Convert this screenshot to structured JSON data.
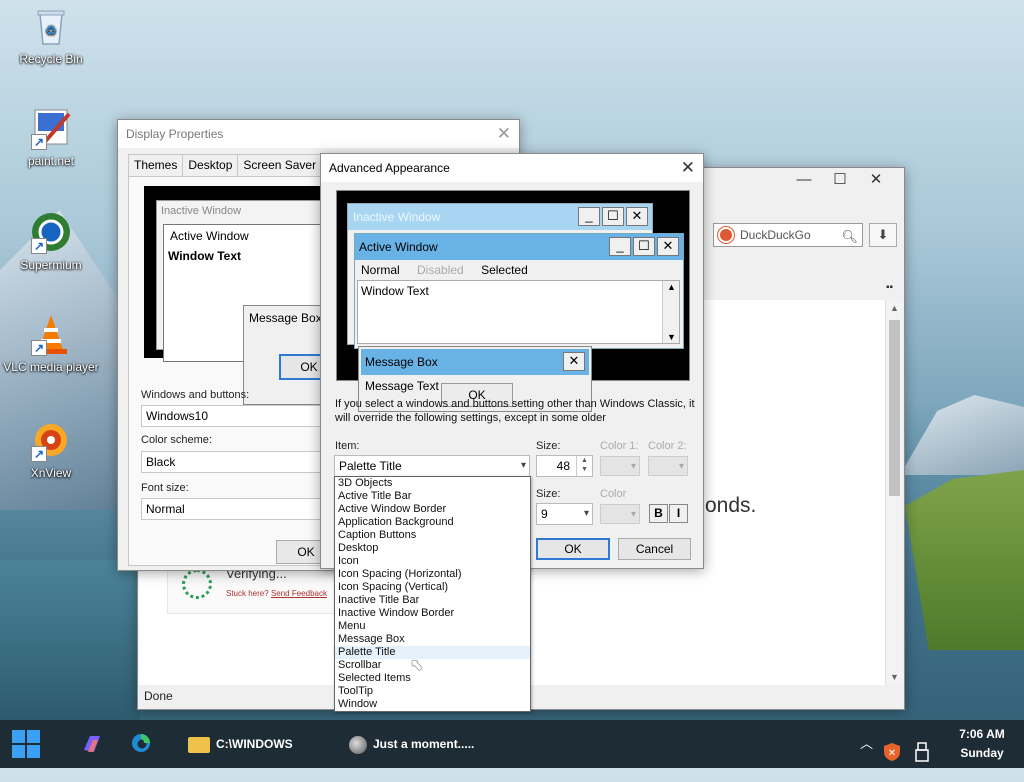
{
  "desktop": {
    "icons": [
      {
        "label": "Recycle Bin"
      },
      {
        "label": "paint.net"
      },
      {
        "label": "Supermium"
      },
      {
        "label": "VLC media player"
      },
      {
        "label": "XnView"
      }
    ]
  },
  "browser": {
    "search_placeholder": "DuckDuckGo",
    "seconds_text": "onds.",
    "verifying": "Verifying...",
    "stuck_text": "Stuck here?",
    "stuck_link": "Send Feedback",
    "status": "Done"
  },
  "display_properties": {
    "title": "Display Properties",
    "tabs": [
      "Themes",
      "Desktop",
      "Screen Saver",
      "A"
    ],
    "preview": {
      "inactive": "Inactive Window",
      "active": "Active Window",
      "window_text": "Window Text",
      "message_box": "Message Box",
      "ok": "OK"
    },
    "windows_buttons_label": "Windows and buttons:",
    "windows_buttons_value": "Windows10",
    "color_scheme_label": "Color scheme:",
    "color_scheme_value": "Black",
    "font_size_label": "Font size:",
    "font_size_value": "Normal",
    "ok": "OK"
  },
  "advanced": {
    "title": "Advanced Appearance",
    "preview": {
      "inactive": "Inactive Window",
      "active": "Active Window",
      "menu_normal": "Normal",
      "menu_disabled": "Disabled",
      "menu_selected": "Selected",
      "window_text": "Window Text",
      "message_box": "Message Box",
      "message_text": "Message Text",
      "ok": "OK"
    },
    "help_text": "If you select a windows and buttons setting other than Windows Classic, it will override the following settings, except in some older",
    "item_label": "Item:",
    "item_value": "Palette Title",
    "size_label": "Size:",
    "size_value": "48",
    "color1_label": "Color 1:",
    "color2_label": "Color 2:",
    "font_size_label": "Size:",
    "font_size_value": "9",
    "font_color_label": "Color",
    "bold": "B",
    "italic": "I",
    "ok": "OK",
    "cancel": "Cancel",
    "item_options": [
      "3D Objects",
      "Active Title Bar",
      "Active Window Border",
      "Application Background",
      "Caption Buttons",
      "Desktop",
      "Icon",
      "Icon Spacing (Horizontal)",
      "Icon Spacing (Vertical)",
      "Inactive Title Bar",
      "Inactive Window Border",
      "Menu",
      "Message Box",
      "Palette Title",
      "Scrollbar",
      "Selected Items",
      "ToolTip",
      "Window"
    ],
    "highlighted_option": "Palette Title"
  },
  "taskbar": {
    "explorer_label": "C:\\WINDOWS",
    "browser_label": "Just a moment.....",
    "time": "7:06 AM",
    "day": "Sunday"
  },
  "colors": {
    "active_title": "#68b2e6",
    "inactive_title": "#a8d6f2",
    "accent": "#2c7ad6",
    "taskbar": "#1d2c35"
  }
}
